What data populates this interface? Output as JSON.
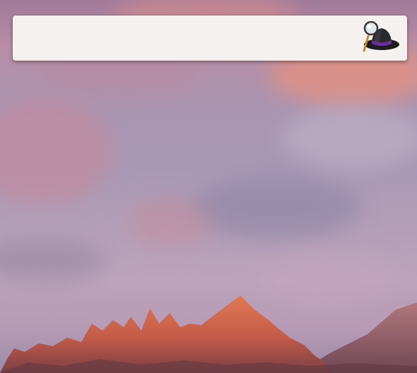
{
  "launcher": {
    "query": "",
    "placeholder": "",
    "logo_icon": "alfred-hat-magnifier-icon"
  },
  "wallpaper": {
    "scene": "mountain-sunset",
    "colors": {
      "sky": "#a898b6",
      "cloud_pink": "#e5917f",
      "mountain": "#d96a4d"
    }
  }
}
